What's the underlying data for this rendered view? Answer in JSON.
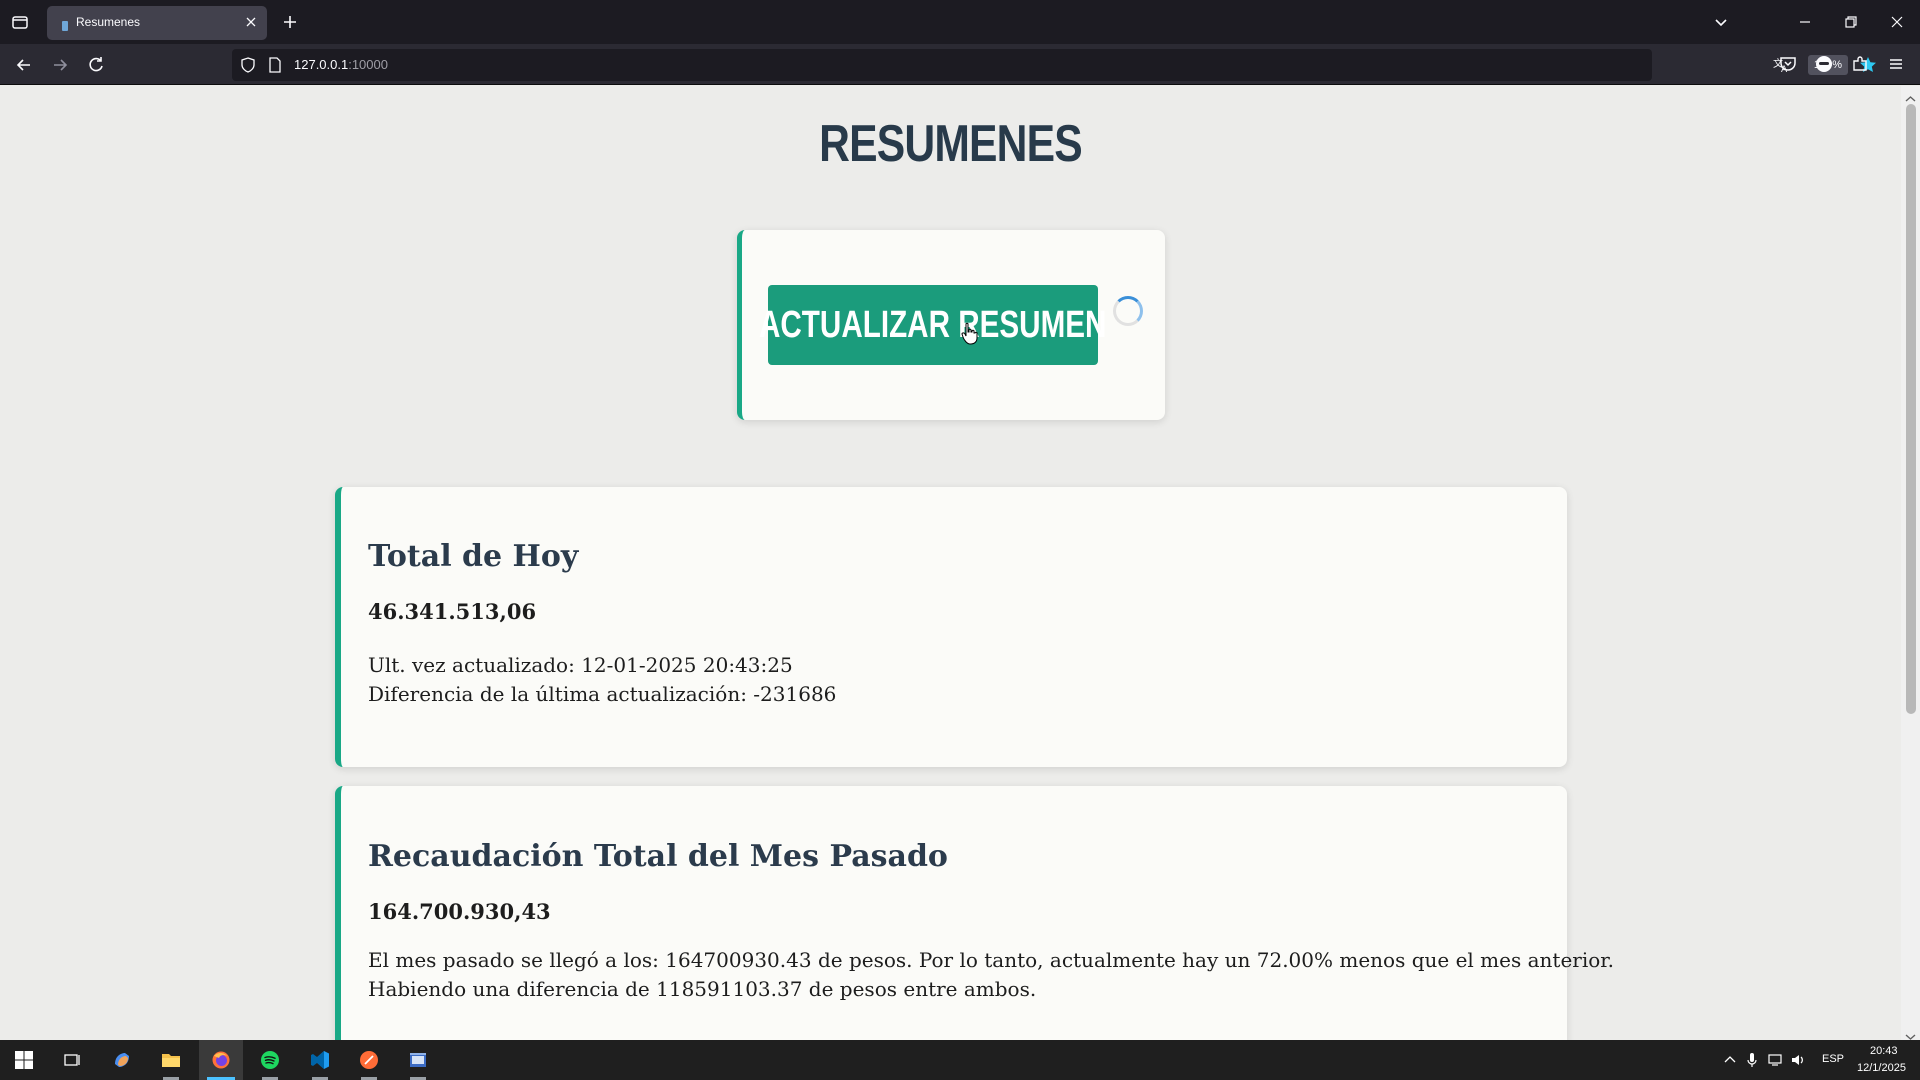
{
  "browser": {
    "tab_title": "Resumenes",
    "url_host": "127.0.0.1",
    "url_port": ":10000",
    "zoom": "130%"
  },
  "page": {
    "title": "RESUMENES",
    "update_button": "ACTUALIZAR RESUMEN"
  },
  "today": {
    "title": "Total de Hoy",
    "amount": "46.341.513,06",
    "last_update": "Ult. vez actualizado: 12-01-2025 20:43:25",
    "difference": "Diferencia de la última actualización: -231686"
  },
  "last_month": {
    "title": "Recaudación Total del Mes Pasado",
    "amount": "164.700.930,43",
    "line1": "El mes pasado se llegó a los: 164700930.43 de pesos. Por lo tanto, actualmente hay un 72.00% menos que el mes anterior.",
    "line2": "Habiendo una diferencia de 118591103.37 de pesos entre ambos."
  },
  "taskbar": {
    "language": "ESP",
    "time": "20:43",
    "date": "12/1/2025"
  },
  "colors": {
    "accent": "#19a886",
    "button": "#1b9c7c",
    "title": "#283a4a"
  }
}
